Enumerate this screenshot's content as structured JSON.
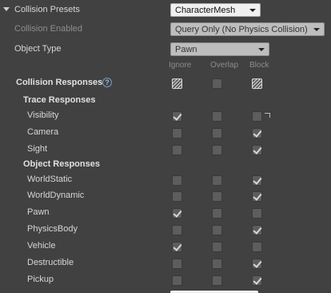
{
  "collision_presets": {
    "label": "Collision Presets",
    "value": "CharacterMesh",
    "collision_enabled_label": "Collision Enabled",
    "collision_enabled_value": "Query Only (No Physics Collision)",
    "object_type_label": "Object Type",
    "object_type_value": "Pawn",
    "columns": [
      "Ignore",
      "Overlap",
      "Block"
    ],
    "responses_label": "Collision Responses",
    "all_state": [
      "mixed",
      "unchecked",
      "mixed"
    ],
    "trace_label": "Trace Responses",
    "trace": [
      {
        "name": "Visibility",
        "state": [
          true,
          false,
          false
        ],
        "modified": true
      },
      {
        "name": "Camera",
        "state": [
          false,
          false,
          true
        ],
        "modified": false
      },
      {
        "name": "Sight",
        "state": [
          false,
          false,
          true
        ],
        "modified": false
      }
    ],
    "object_label": "Object Responses",
    "object": [
      {
        "name": "WorldStatic",
        "state": [
          false,
          false,
          true
        ]
      },
      {
        "name": "WorldDynamic",
        "state": [
          false,
          false,
          true
        ]
      },
      {
        "name": "Pawn",
        "state": [
          true,
          false,
          false
        ]
      },
      {
        "name": "PhysicsBody",
        "state": [
          false,
          false,
          true
        ]
      },
      {
        "name": "Vehicle",
        "state": [
          true,
          false,
          false
        ]
      },
      {
        "name": "Destructible",
        "state": [
          false,
          false,
          true
        ]
      },
      {
        "name": "Pickup",
        "state": [
          false,
          false,
          true
        ]
      }
    ]
  }
}
